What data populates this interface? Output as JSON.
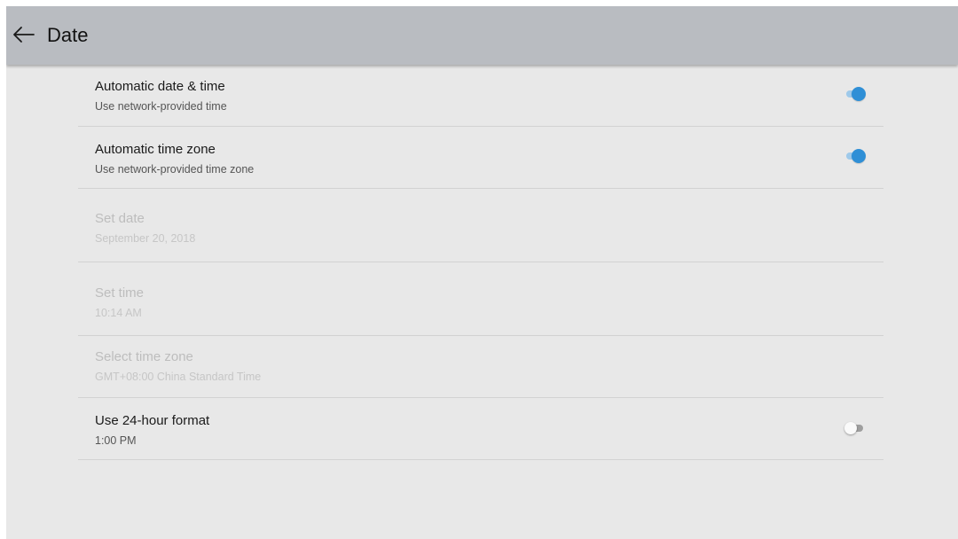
{
  "header": {
    "title": "Date",
    "back_icon": "arrow-left-icon"
  },
  "colors": {
    "appbar": "#b9bcc1",
    "background": "#e8e8e8",
    "accent": "#2f8fd6"
  },
  "settings": [
    {
      "title": "Automatic date & time",
      "summary": "Use network-provided time",
      "toggle": "on",
      "enabled": true
    },
    {
      "title": "Automatic time zone",
      "summary": "Use network-provided time zone",
      "toggle": "on",
      "enabled": true
    },
    {
      "title": "Set date",
      "summary": "September 20, 2018",
      "enabled": false
    },
    {
      "title": "Set time",
      "summary": "10:14 AM",
      "enabled": false
    },
    {
      "title": "Select time zone",
      "summary": "GMT+08:00 China Standard Time",
      "enabled": false
    },
    {
      "title": "Use 24-hour format",
      "summary": "1:00 PM",
      "toggle": "off",
      "enabled": true
    }
  ]
}
